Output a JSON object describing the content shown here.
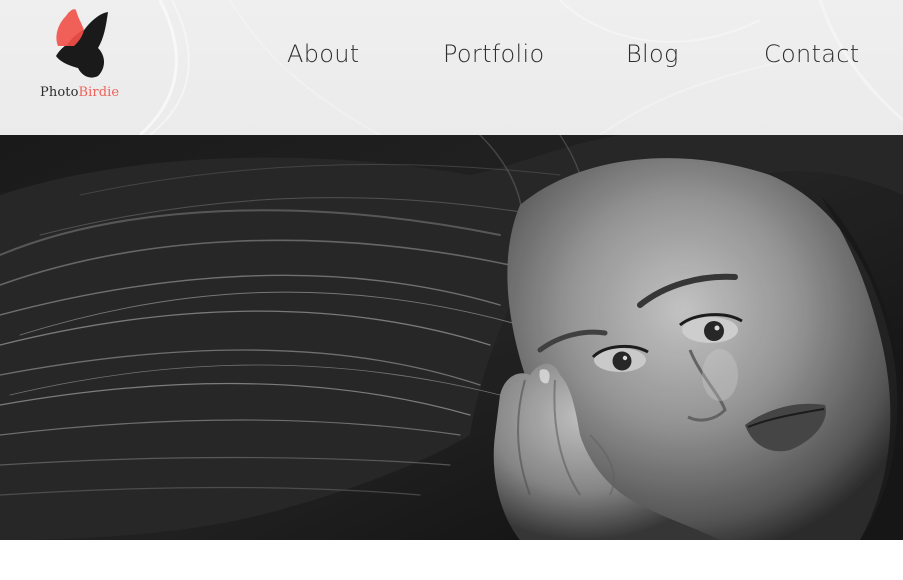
{
  "brand": {
    "logo_icon": "butterfly-bird-icon",
    "name_part1": "Photo",
    "name_part2": "Birdie",
    "accent_color": "#f06058",
    "dark_color": "#1a1a1a"
  },
  "nav": {
    "items": [
      {
        "label": "About"
      },
      {
        "label": "Portfolio"
      },
      {
        "label": "Blog"
      },
      {
        "label": "Contact"
      }
    ]
  },
  "hero": {
    "image": "black-and-white-portrait-woman-hair"
  }
}
